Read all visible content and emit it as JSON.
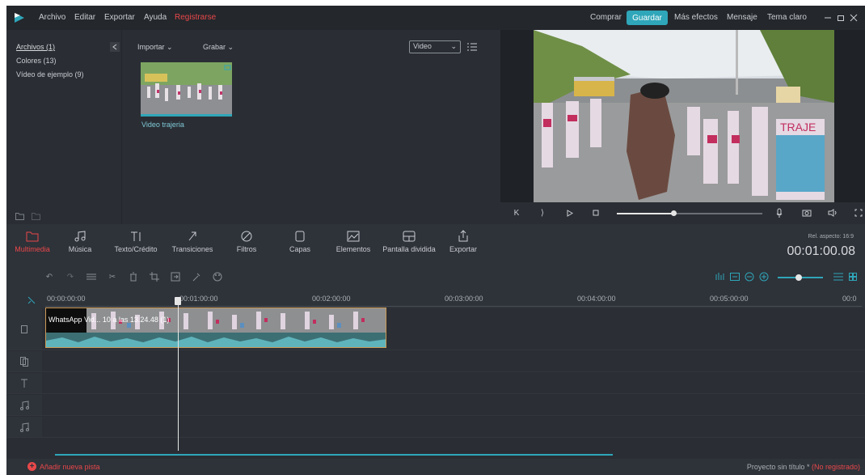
{
  "menu": [
    "Archivo",
    "Editar",
    "Exportar",
    "Ayuda"
  ],
  "register": "Registrarse",
  "right_menu": {
    "buy": "Comprar",
    "save": "Guardar",
    "effects": "Más efectos",
    "message": "Mensaje",
    "theme": "Tema claro"
  },
  "library": {
    "items": [
      "Archivos (1)",
      "Colores (13)",
      "Vídeo de ejemplo (9)"
    ],
    "import": "Importar",
    "record": "Grabar",
    "filter": "Video",
    "thumb_label": "Video trajeria"
  },
  "tools": [
    {
      "label": "Multimedia",
      "active": true
    },
    {
      "label": "Música"
    },
    {
      "label": "Texto/Crédito"
    },
    {
      "label": "Transiciones"
    },
    {
      "label": "Filtros"
    },
    {
      "label": "Capas"
    },
    {
      "label": "Elementos"
    },
    {
      "label": "Pantalla dividida"
    },
    {
      "label": "Exportar"
    }
  ],
  "aspect": "Rel. aspecto: 16:9",
  "timecode": "00:01:00.08",
  "ruler": [
    "00:00:00:00",
    "00:01:00:00",
    "00:02:00:00",
    "00:03:00:00",
    "00:04:00:00",
    "00:05:00:00",
    "00:0"
  ],
  "clip_label": "WhatsApp Vid... 10 a las 13.24.48 (1)",
  "add_track": "Añadir nueva pista",
  "project": "Proyecto sin título *",
  "unregistered": "(No registrado)",
  "colors": {
    "accent": "#2fa6b9",
    "red": "#e8484a"
  }
}
